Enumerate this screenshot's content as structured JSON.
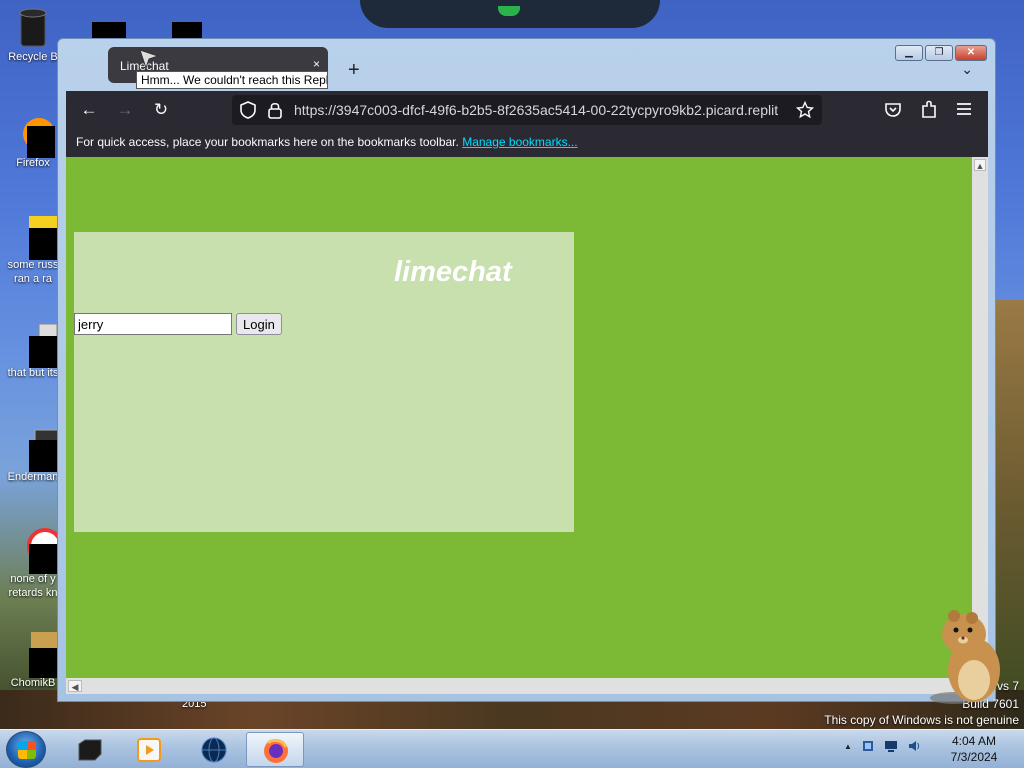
{
  "desktop": {
    "icons": [
      {
        "label": "Recycle B"
      },
      {
        "label": "Firefox"
      },
      {
        "label": "some russ\nran a ra"
      },
      {
        "label": "that but its"
      },
      {
        "label": "Enderman"
      },
      {
        "label": "none of y\nretards kn"
      },
      {
        "label": "ChomikB"
      }
    ],
    "behind_window_text": "2015"
  },
  "browser": {
    "tab": {
      "title": "Limechat",
      "close": "×"
    },
    "tooltip": "Hmm... We couldn't reach this Repl",
    "new_tab": "+",
    "tab_list": "⌄",
    "nav": {
      "back": "←",
      "forward": "→",
      "reload": "↻"
    },
    "url": "https://3947c003-dfcf-49f6-b2b5-8f2635ac5414-00-22tycpyro9kb2.picard.replit",
    "bookmarks_bar": {
      "text": "For quick access, place your bookmarks here on the bookmarks toolbar.",
      "link": "Manage bookmarks..."
    },
    "colors": {
      "page_bg": "#7cb934",
      "panel_bg": "#c7e0ae",
      "toolbar": "#2b2a33"
    }
  },
  "page": {
    "brand": "limechat",
    "username_value": "jerry",
    "login_label": "Login"
  },
  "watermark": {
    "line1": "vs 7",
    "line2": "Build 7601",
    "line3": "This copy of Windows is not genuine"
  },
  "taskbar": {
    "clock_time": "4:04 AM",
    "clock_date": "7/3/2024",
    "tray_arrow": "▲"
  }
}
